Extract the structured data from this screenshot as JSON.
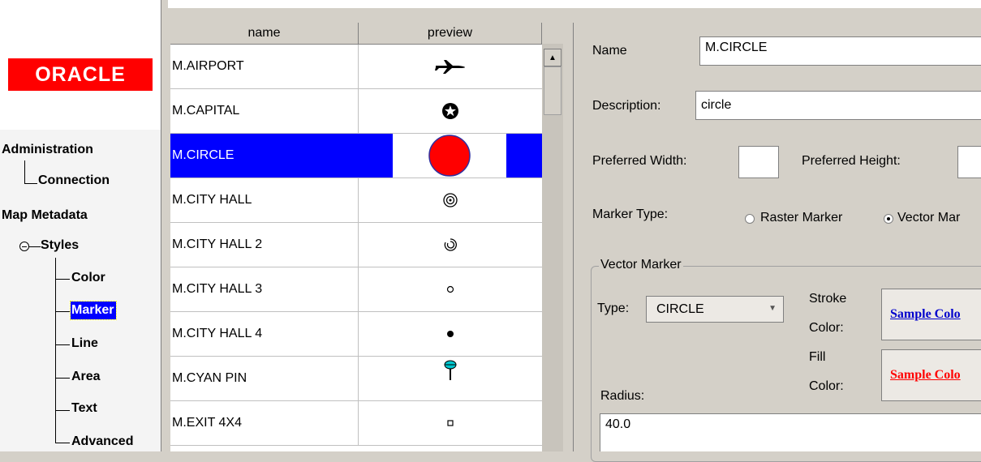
{
  "brand": {
    "logo_text": "ORACLE"
  },
  "nav": {
    "administration": "Administration",
    "connection": "Connection",
    "map_metadata": "Map Metadata",
    "styles": "Styles",
    "color": "Color",
    "marker": "Marker",
    "line": "Line",
    "area": "Area",
    "text": "Text",
    "advanced": "Advanced",
    "selected": "Marker"
  },
  "table": {
    "headers": [
      "name",
      "preview"
    ],
    "rows": [
      {
        "name": "M.AIRPORT",
        "preview_icon": "airplane-icon"
      },
      {
        "name": "M.CAPITAL",
        "preview_icon": "star-in-circle-icon"
      },
      {
        "name": "M.CIRCLE",
        "preview_icon": "red-circle-icon"
      },
      {
        "name": "M.CITY HALL",
        "preview_icon": "concentric-circles-icon"
      },
      {
        "name": "M.CITY HALL 2",
        "preview_icon": "spiral-circle-icon"
      },
      {
        "name": "M.CITY HALL 3",
        "preview_icon": "small-circle-icon"
      },
      {
        "name": "M.CITY HALL 4",
        "preview_icon": "filled-dot-icon"
      },
      {
        "name": "M.CYAN PIN",
        "preview_icon": "cyan-pin-icon"
      },
      {
        "name": "M.EXIT 4X4",
        "preview_icon": "small-square-icon"
      }
    ],
    "selected": "M.CIRCLE"
  },
  "form": {
    "name_label": "Name",
    "name_value": "M.CIRCLE",
    "description_label": "Description:",
    "description_value": "circle",
    "preferred_width_label": "Preferred Width:",
    "preferred_width_value": "",
    "preferred_height_label": "Preferred Height:",
    "preferred_height_value": "",
    "marker_type_label": "Marker Type:",
    "raster_option": "Raster Marker",
    "vector_option": "Vector Mar",
    "selected_marker_type": "Vector Marker",
    "vector_group_title": "Vector Marker",
    "type_label": "Type:",
    "type_value": "CIRCLE",
    "stroke_color_label_1": "Stroke",
    "stroke_color_label_2": "Color:",
    "stroke_sample": "Sample Colo",
    "fill_color_label_1": "Fill",
    "fill_color_label_2": "Color:",
    "fill_sample": "Sample Colo",
    "radius_label": "Radius:",
    "radius_value": "40.0"
  },
  "colors": {
    "selection": "#0000ff",
    "logo": "#ff0000",
    "stroke_sample_text": "#0000cc",
    "fill_sample_text": "#ff0000",
    "circle_fill": "#ff0000",
    "pin_color": "#00c8d0"
  }
}
